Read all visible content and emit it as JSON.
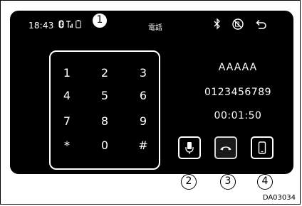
{
  "status_bar": {
    "time": "18:43",
    "icons_left": [
      "bluetooth-small-icon",
      "signal-icon",
      "battery-icon"
    ],
    "title": "電話",
    "icons_right": [
      "bluetooth-icon",
      "mute-icon",
      "back-icon"
    ]
  },
  "keypad": {
    "keys": [
      "1",
      "2",
      "3",
      "4",
      "5",
      "6",
      "7",
      "8",
      "9",
      "*",
      "0",
      "#"
    ]
  },
  "call": {
    "name": "AAAAA",
    "number": "0123456789",
    "duration": "00:01:50"
  },
  "buttons": {
    "mic": "microphone-mute-icon",
    "end": "end-call-icon",
    "handset": "phone-device-icon"
  },
  "callouts": [
    "1",
    "2",
    "3",
    "4"
  ],
  "figure_code": "DA03034"
}
